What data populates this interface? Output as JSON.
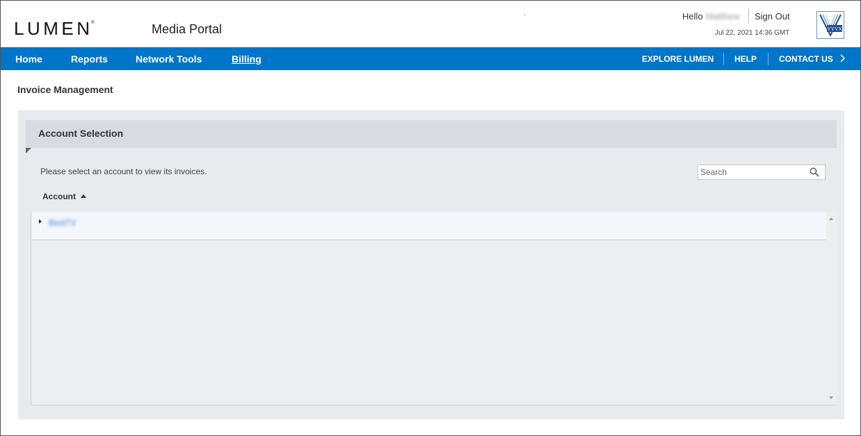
{
  "brand": {
    "logo_text": "LUMEN",
    "registered_mark": "®",
    "accent_color": "#0075c9"
  },
  "header": {
    "portal_title": "Media Portal",
    "greeting_prefix": "Hello",
    "user_name": "Matthew",
    "sign_out_label": "Sign Out",
    "timestamp": "Jul 22, 2021 14:36 GMT",
    "partner_logo_text": "VYVX"
  },
  "nav": {
    "left": [
      "Home",
      "Reports",
      "Network Tools",
      "Billing"
    ],
    "active": "Billing",
    "right": [
      "EXPLORE LUMEN",
      "HELP",
      "CONTACT US"
    ]
  },
  "page": {
    "title": "Invoice Management"
  },
  "account_selection": {
    "title": "Account Selection",
    "instructions": "Please select an account to view its invoices.",
    "search_placeholder": "Search",
    "column_header": "Account",
    "sort_direction": "ascending",
    "rows": [
      {
        "label": "BestTV",
        "expanded": false
      }
    ]
  }
}
